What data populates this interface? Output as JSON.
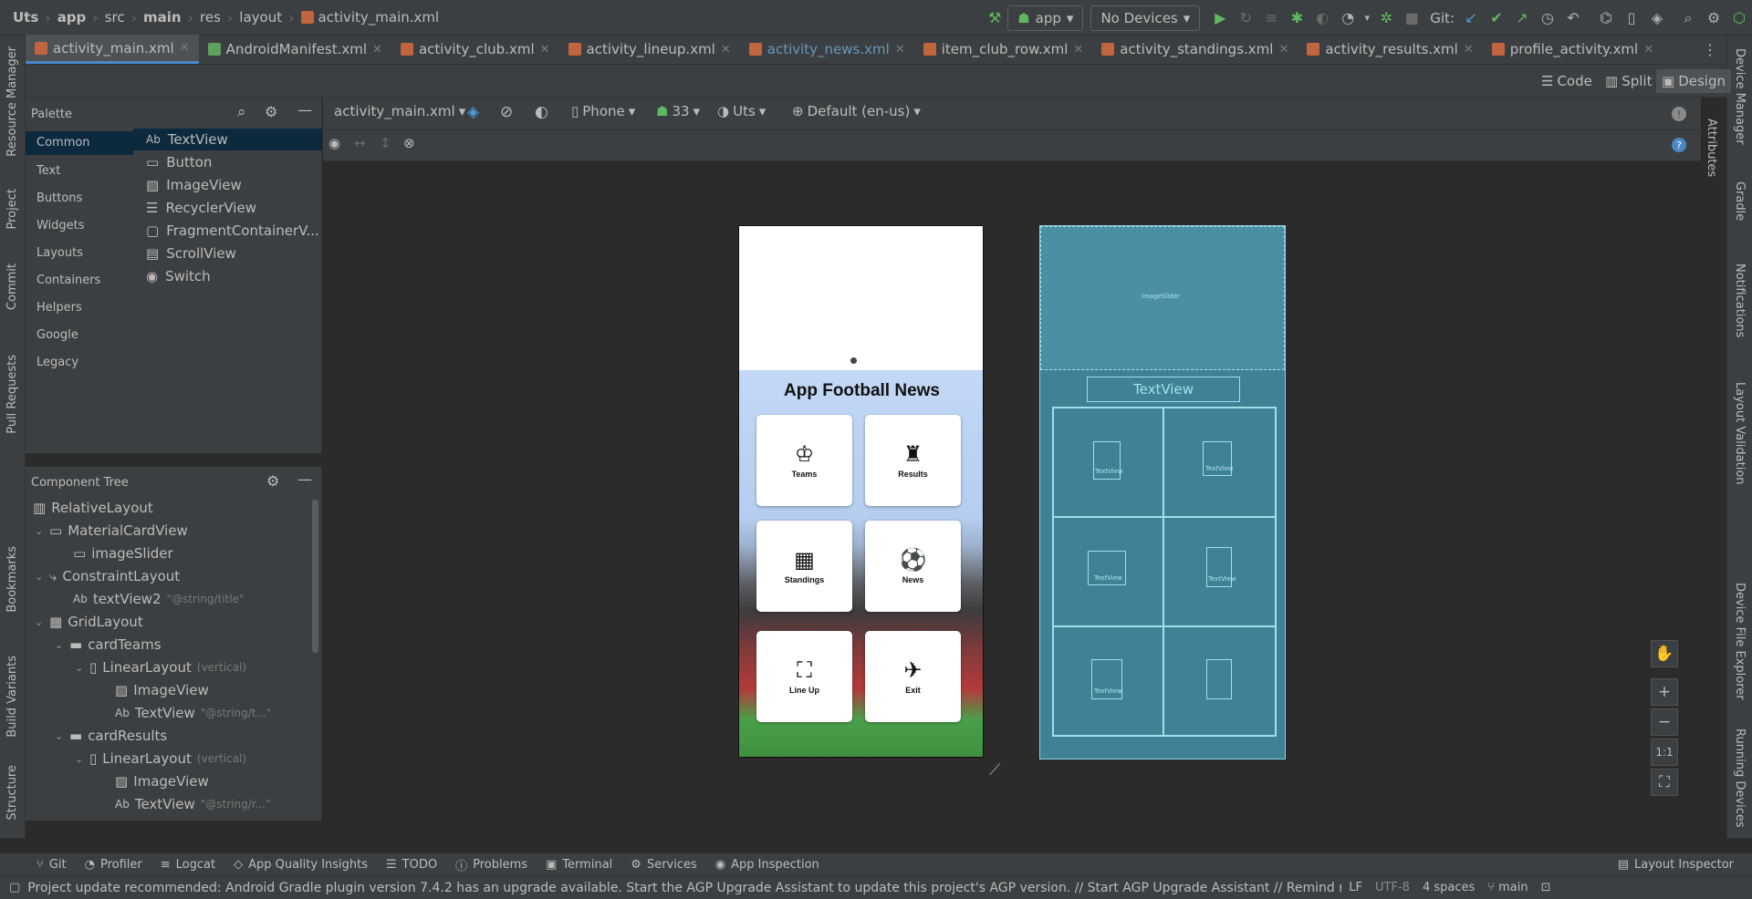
{
  "breadcrumb": [
    "Uts",
    "app",
    "src",
    "main",
    "res",
    "layout",
    "activity_main.xml"
  ],
  "toolbar": {
    "run_config": "app",
    "device": "No Devices",
    "git_label": "Git:"
  },
  "tabs": [
    {
      "label": "activity_main.xml",
      "active": true
    },
    {
      "label": "AndroidManifest.xml"
    },
    {
      "label": "activity_club.xml"
    },
    {
      "label": "activity_lineup.xml"
    },
    {
      "label": "activity_news.xml"
    },
    {
      "label": "item_club_row.xml"
    },
    {
      "label": "activity_standings.xml"
    },
    {
      "label": "activity_results.xml"
    },
    {
      "label": "profile_activity.xml"
    }
  ],
  "view_modes": {
    "code": "Code",
    "split": "Split",
    "design": "Design"
  },
  "left_strip": [
    "Resource Manager",
    "Project",
    "Commit",
    "Pull Requests",
    "Bookmarks",
    "Build Variants",
    "Structure"
  ],
  "right_strip": [
    "Device Manager",
    "Gradle",
    "Notifications",
    "Layout Validation",
    "Device File Explorer",
    "Running Devices"
  ],
  "attributes_label": "Attributes",
  "palette": {
    "title": "Palette",
    "categories": [
      "Common",
      "Text",
      "Buttons",
      "Widgets",
      "Layouts",
      "Containers",
      "Helpers",
      "Google",
      "Legacy"
    ],
    "items": [
      "TextView",
      "Button",
      "ImageView",
      "RecyclerView",
      "FragmentContainerV...",
      "ScrollView",
      "Switch"
    ]
  },
  "component_tree": {
    "title": "Component Tree",
    "nodes": [
      {
        "label": "RelativeLayout",
        "hint": ""
      },
      {
        "label": "MaterialCardView",
        "hint": ""
      },
      {
        "label": "imageSlider",
        "hint": ""
      },
      {
        "label": "ConstraintLayout",
        "hint": ""
      },
      {
        "label": "textView2",
        "hint": "\"@string/title\""
      },
      {
        "label": "GridLayout",
        "hint": ""
      },
      {
        "label": "cardTeams",
        "hint": ""
      },
      {
        "label": "LinearLayout",
        "hint": "(vertical)"
      },
      {
        "label": "ImageView",
        "hint": ""
      },
      {
        "label": "TextView",
        "hint": "\"@string/t...\""
      },
      {
        "label": "cardResults",
        "hint": ""
      },
      {
        "label": "LinearLayout",
        "hint": "(vertical)"
      },
      {
        "label": "ImageView",
        "hint": ""
      },
      {
        "label": "TextView",
        "hint": "\"@string/r...\""
      }
    ]
  },
  "design_toolbar": {
    "file": "activity_main.xml",
    "device": "Phone",
    "api": "33",
    "theme": "Uts",
    "locale": "Default (en-us)"
  },
  "preview": {
    "title": "App Football News",
    "cards": [
      {
        "label": "Teams",
        "icon": "league-badge-icon"
      },
      {
        "label": "Results",
        "icon": "trophy-icon"
      },
      {
        "label": "Standings",
        "icon": "table-icon"
      },
      {
        "label": "News",
        "icon": "tv-ball-icon"
      },
      {
        "label": "Line Up",
        "icon": "pitch-icon"
      },
      {
        "label": "Exit",
        "icon": "exit-player-icon"
      }
    ]
  },
  "blueprint": {
    "image_slider": "imageSlider",
    "title": "TextView",
    "cell_label": "TextView"
  },
  "zoom": {
    "reset": "1:1"
  },
  "bottom_tools": [
    "Git",
    "Profiler",
    "Logcat",
    "App Quality Insights",
    "TODO",
    "Problems",
    "Terminal",
    "Services",
    "App Inspection"
  ],
  "layout_inspector": "Layout Inspector",
  "status": {
    "message": "Project update recommended: Android Gradle plugin version 7.4.2 has an upgrade available.  Start the AGP Upgrade Assistant to update this project's AGP version. // Start AGP Upgrade Assistant // Remind me tomorrow // Don't... (a minu",
    "line_sep": "LF",
    "encoding": "UTF-8",
    "indent": "4 spaces",
    "branch": "main"
  }
}
